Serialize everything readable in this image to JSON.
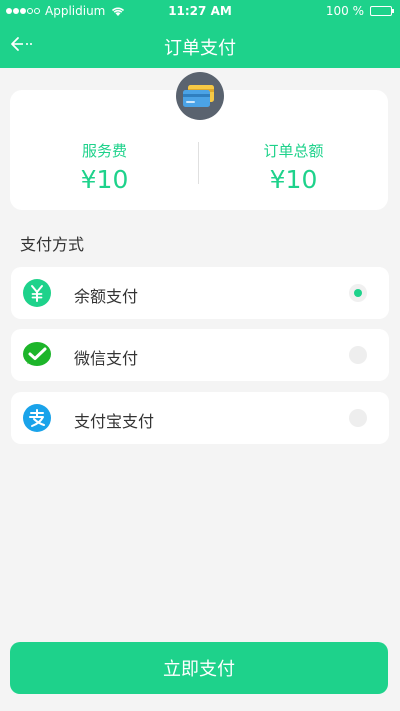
{
  "status_bar": {
    "carrier": "Applidium",
    "time": "11:27 AM",
    "battery": "100 %"
  },
  "header": {
    "title": "订单支付",
    "back_icon": "back-arrow-icon"
  },
  "summary": {
    "icon": "credit-card-icon",
    "service_fee_label": "服务费",
    "service_fee_value": "¥10",
    "order_total_label": "订单总额",
    "order_total_value": "¥10"
  },
  "payment": {
    "section_label": "支付方式",
    "methods": [
      {
        "name": "余额支付",
        "icon": "yuan-balance-icon",
        "selected": true
      },
      {
        "name": "微信支付",
        "icon": "wechat-icon",
        "selected": false
      },
      {
        "name": "支付宝支付",
        "icon": "alipay-icon",
        "selected": false
      }
    ]
  },
  "actions": {
    "pay_now_label": "立即支付"
  },
  "colors": {
    "accent": "#1ed28b",
    "wechat": "#1db52a",
    "alipay": "#1aa3ea",
    "card_icon_bg": "#5a636f"
  }
}
